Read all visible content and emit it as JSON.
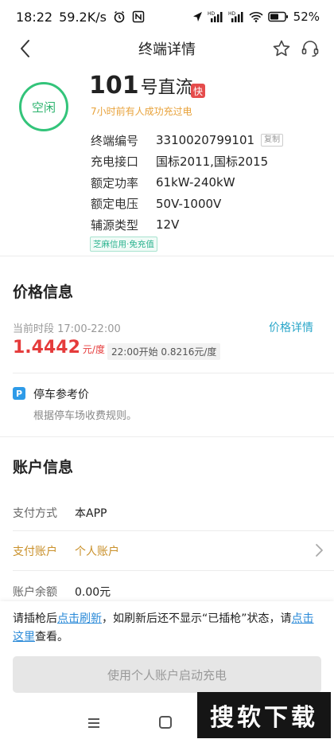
{
  "status_bar": {
    "time": "18:22",
    "network_speed": "59.2K/s",
    "battery": "52%",
    "icons": [
      "alarm-icon",
      "nfc-icon",
      "location-icon",
      "signal-hd-icon",
      "signal-hd-icon",
      "wifi-icon",
      "battery-icon"
    ]
  },
  "header": {
    "title": "终端详情"
  },
  "terminal": {
    "status": "空闲",
    "number": "101",
    "type": "号直流",
    "fast_badge": "快",
    "last_charge": "7小时前有人成功充过电",
    "info": [
      {
        "label": "终端编号",
        "value": "3310020799101"
      },
      {
        "label": "充电接口",
        "value": "国标2011,国标2015"
      },
      {
        "label": "额定功率",
        "value": "61kW-240kW"
      },
      {
        "label": "额定电压",
        "value": "50V-1000V"
      },
      {
        "label": "辅源类型",
        "value": "12V"
      }
    ],
    "copy_label": "复制",
    "sesame_tag": "芝麻信用·免充值"
  },
  "price": {
    "section_title": "价格信息",
    "period_label": "当前时段 17:00-22:00",
    "detail_link": "价格详情",
    "current_price": "1.4442",
    "unit": "元/度",
    "next_price": "22:00开始  0.8216元/度"
  },
  "parking": {
    "icon_letter": "P",
    "title": "停车参考价",
    "desc": "根据停车场收费规则。"
  },
  "account": {
    "section_title": "账户信息",
    "payment_method_label": "支付方式",
    "payment_method_value": "本APP",
    "payment_account_label": "支付账户",
    "payment_account_value": "个人账户",
    "balance_label": "账户余额",
    "balance_value": "0.00元"
  },
  "footer": {
    "hint_part1": "请插枪后",
    "refresh_link": "点击刷新",
    "hint_part2": "，如刷新后还不显示“已插枪”状态，请",
    "here_link": "点击这里",
    "hint_part3": "查看。",
    "start_button": "使用个人账户启动充电"
  },
  "watermark": "搜软下载",
  "colors": {
    "accent_green": "#33c47a",
    "price_red": "#e53b3b",
    "link_blue": "#2a8ad8",
    "gold": "#c9902a"
  }
}
